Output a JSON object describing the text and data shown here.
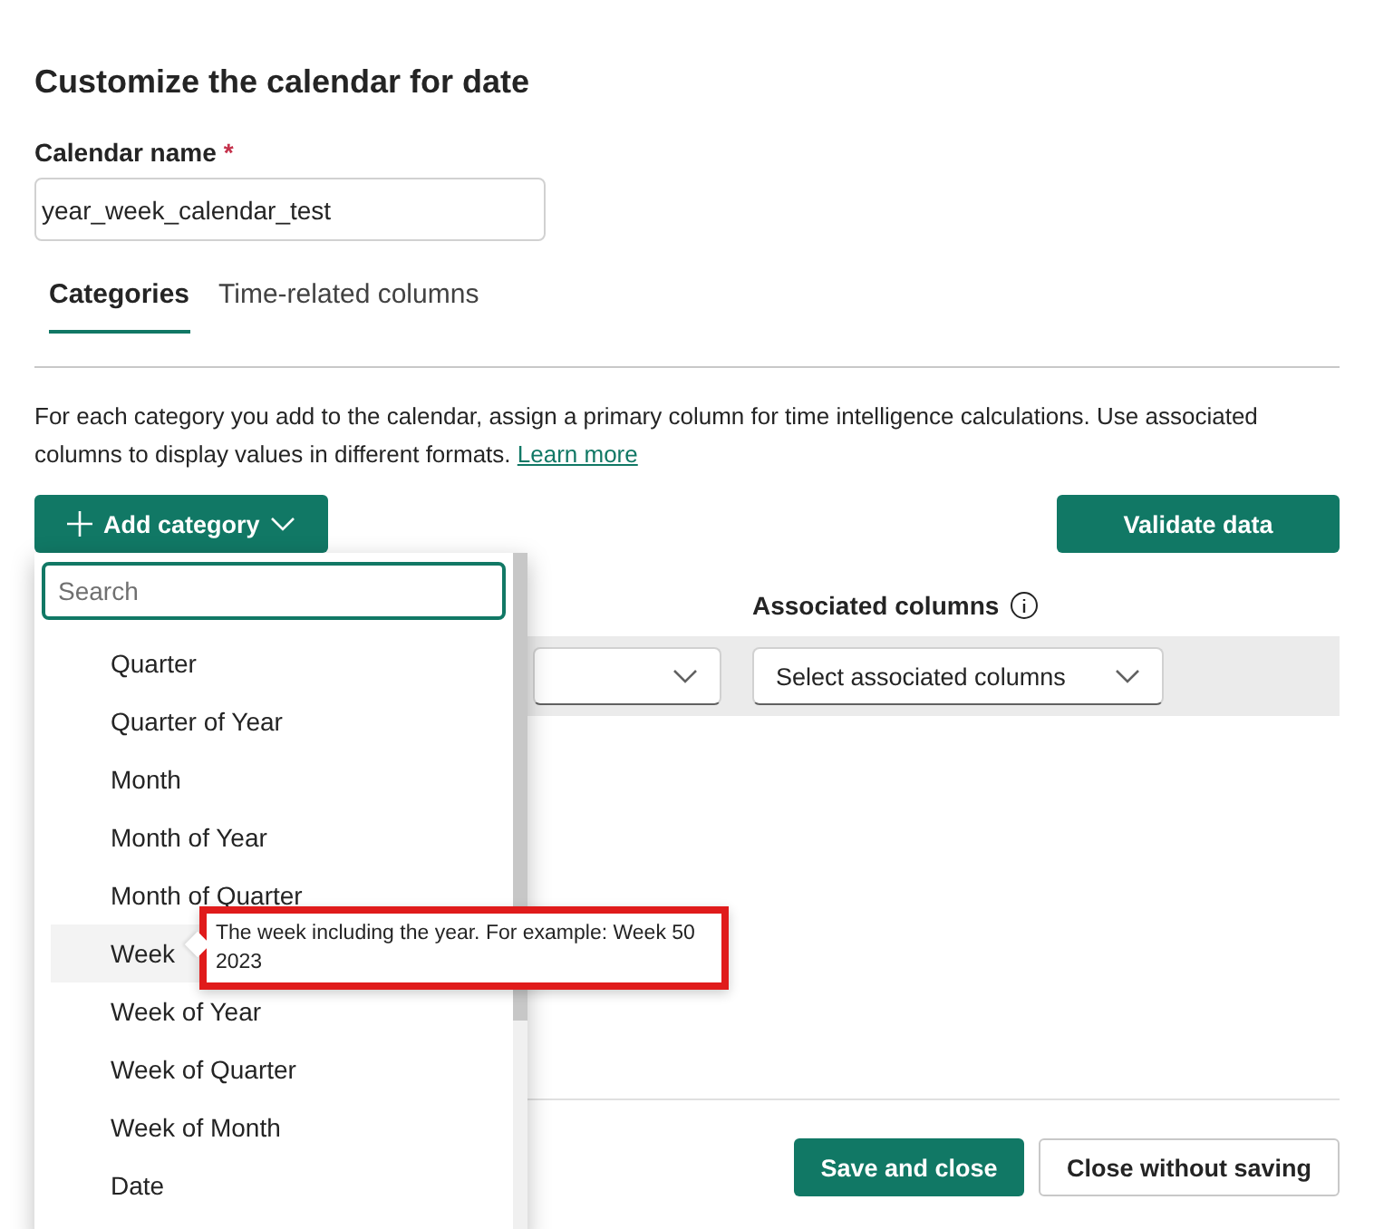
{
  "title": "Customize the calendar for date",
  "calendar_name": {
    "label": "Calendar name",
    "required_mark": "*",
    "value": "year_week_calendar_test"
  },
  "tabs": [
    {
      "label": "Categories",
      "selected": true
    },
    {
      "label": "Time-related columns",
      "selected": false
    }
  ],
  "description": {
    "text": "For each category you add to the calendar, assign a primary column for time intelligence calculations. Use associated columns to display values in different formats.",
    "link": "Learn more"
  },
  "add_category_button": "Add category",
  "validate_button": "Validate data",
  "associated_columns": {
    "header": "Associated columns",
    "placeholder": "Select associated columns"
  },
  "dropdown": {
    "search_placeholder": "Search",
    "items": [
      {
        "label": "Quarter",
        "selected": false
      },
      {
        "label": "Quarter of Year",
        "selected": false
      },
      {
        "label": "Month",
        "selected": false
      },
      {
        "label": "Month of Year",
        "selected": false
      },
      {
        "label": "Month of Quarter",
        "selected": false
      },
      {
        "label": "Week",
        "selected": true
      },
      {
        "label": "Week of Year",
        "selected": false
      },
      {
        "label": "Week of Quarter",
        "selected": false
      },
      {
        "label": "Week of Month",
        "selected": false
      },
      {
        "label": "Date",
        "selected": false
      }
    ]
  },
  "tooltip": "The week including the year. For example: Week 50 2023",
  "footer_buttons": [
    {
      "label": "Save and close",
      "kind": "primary"
    },
    {
      "label": "Close without saving",
      "kind": "secondary"
    }
  ]
}
